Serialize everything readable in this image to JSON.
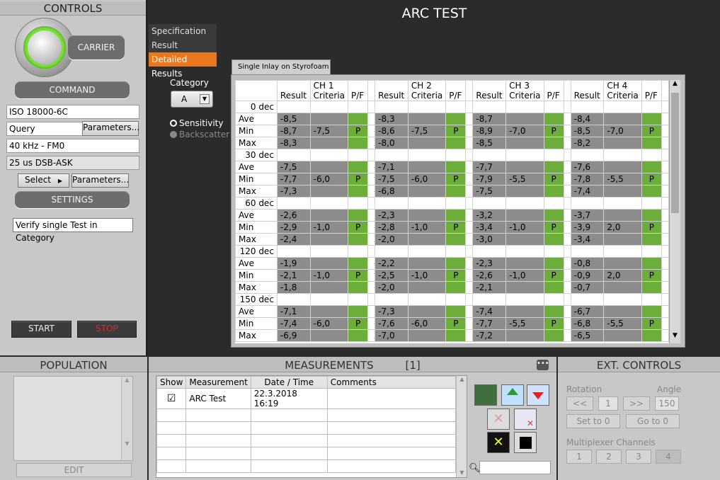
{
  "controls": {
    "title": "CONTROLS",
    "carrier": "CARRIER",
    "command": "COMMAND",
    "protocol": "ISO 18000-6C",
    "query": "Query",
    "parameters1": "Parameters...",
    "link": "40 kHz - FM0",
    "modulation": "25 us DSB-ASK",
    "select": "Select",
    "parameters2": "Parameters...",
    "settings": "SETTINGS",
    "verify": "Verify single Test in Category",
    "start": "START",
    "stop": "STOP"
  },
  "main": {
    "title": "ARC TEST",
    "tabs": [
      "Specification",
      "Result Overview",
      "Detailed Results"
    ],
    "category_label": "Category",
    "category_value": "A",
    "radio_sensitivity": "Sensitivity",
    "radio_backscatter": "Backscatter",
    "grid_tab": "Single Inlay on Styrofoam"
  },
  "grid": {
    "channels": [
      "CH 1",
      "CH 2",
      "CH 3",
      "CH 4"
    ],
    "col_result": "Result",
    "col_criteria": "Criteria",
    "col_pf": "P/F",
    "row_labels": [
      "Ave",
      "Min",
      "Max"
    ],
    "angles": [
      {
        "angle": "0 dec",
        "ave": [
          "-8,5",
          "-8,3",
          "-8,7",
          "-8,4"
        ],
        "min": [
          "-8,7",
          "-8,6",
          "-8,9",
          "-8,5"
        ],
        "max": [
          "-8,3",
          "-8,0",
          "-8,5",
          "-8,2"
        ],
        "crit": [
          "-7,5",
          "-7,5",
          "-7,0",
          "-7,0"
        ],
        "pf": [
          "P",
          "P",
          "P",
          "P"
        ]
      },
      {
        "angle": "30 dec",
        "ave": [
          "-7,5",
          "-7,1",
          "-7,7",
          "-7,6"
        ],
        "min": [
          "-7,7",
          "-7,5",
          "-7,9",
          "-7,8"
        ],
        "max": [
          "-7,3",
          "-6,8",
          "-7,5",
          "-7,4"
        ],
        "crit": [
          "-6,0",
          "-6,0",
          "-5,5",
          "-5,5"
        ],
        "pf": [
          "P",
          "P",
          "P",
          "P"
        ]
      },
      {
        "angle": "60 dec",
        "ave": [
          "-2,6",
          "-2,3",
          "-3,2",
          "-3,7"
        ],
        "min": [
          "-2,9",
          "-2,8",
          "-3,4",
          "-3,9"
        ],
        "max": [
          "-2,4",
          "-2,0",
          "-3,0",
          "-3,4"
        ],
        "crit": [
          "-1,0",
          "-1,0",
          "-1,0",
          "2,0"
        ],
        "pf": [
          "P",
          "P",
          "P",
          "P"
        ]
      },
      {
        "angle": "120 dec",
        "ave": [
          "-1,9",
          "-2,2",
          "-2,3",
          "-0,8"
        ],
        "min": [
          "-2,1",
          "-2,5",
          "-2,6",
          "-0,9"
        ],
        "max": [
          "-1,8",
          "-2,0",
          "-2,1",
          "-0,7"
        ],
        "crit": [
          "-1,0",
          "-1,0",
          "-1,0",
          "2,0"
        ],
        "pf": [
          "P",
          "P",
          "P",
          "P"
        ]
      },
      {
        "angle": "150 dec",
        "ave": [
          "-7,1",
          "-7,3",
          "-7,4",
          "-6,7"
        ],
        "min": [
          "-7,4",
          "-7,6",
          "-7,7",
          "-6,8"
        ],
        "max": [
          "-6,9",
          "-7,0",
          "-7,2",
          "-6,5"
        ],
        "crit": [
          "-6,0",
          "-6,0",
          "-5,5",
          "-5,5"
        ],
        "pf": [
          "P",
          "P",
          "P",
          "P"
        ]
      }
    ]
  },
  "population": {
    "title": "POPULATION",
    "edit": "EDIT"
  },
  "measurements": {
    "title": "MEASUREMENTS",
    "count": "[1]",
    "headers": [
      "Show",
      "Measurement",
      "Date / Time",
      "Comments"
    ],
    "rows": [
      {
        "show": "☑",
        "name": "ARC Test",
        "datetime": "22.3.2018 16:19",
        "comment": ""
      }
    ]
  },
  "ext": {
    "title": "EXT. CONTROLS",
    "rotation": "Rotation",
    "angle": "Angle",
    "prev": "<<",
    "rot_value": "1",
    "next": ">>",
    "angle_value": "150",
    "set_to_0": "Set to 0",
    "go_to_0": "Go to 0",
    "mux_label": "Multiplexer Channels",
    "mux": [
      "1",
      "2",
      "3",
      "4"
    ]
  }
}
